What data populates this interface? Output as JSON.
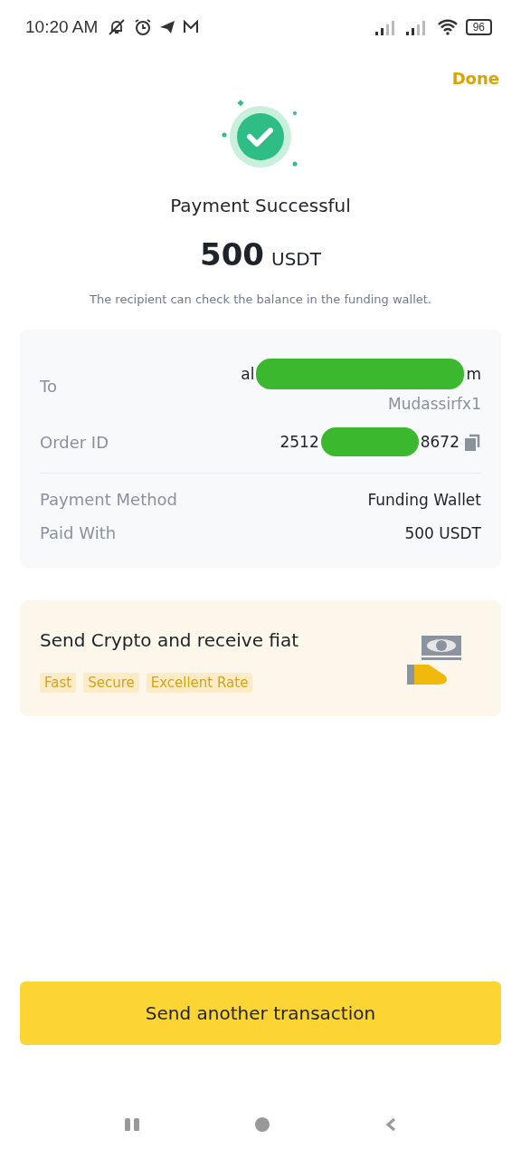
{
  "status_bar": {
    "time": "10:20 AM",
    "battery": "96"
  },
  "header": {
    "done": "Done"
  },
  "result": {
    "title": "Payment Successful",
    "amount": "500",
    "currency": "USDT",
    "note": "The recipient can check the balance in the funding wallet."
  },
  "details": [
    {
      "kind": "recipient",
      "label": "To",
      "value_start": "al",
      "value_end": "m",
      "sub": "Mudassirfx1"
    },
    {
      "kind": "order",
      "label": "Order ID",
      "value_start": "2512",
      "value_end": "8672"
    },
    {
      "kind": "divider"
    },
    {
      "kind": "plain",
      "label": "Payment Method",
      "value": "Funding Wallet"
    },
    {
      "kind": "plain",
      "label": "Paid With",
      "value": "500 USDT"
    }
  ],
  "promo": {
    "title": "Send Crypto and receive fiat",
    "tags": [
      "Fast",
      "Secure",
      "Excellent Rate"
    ]
  },
  "primary_button": "Send another transaction"
}
